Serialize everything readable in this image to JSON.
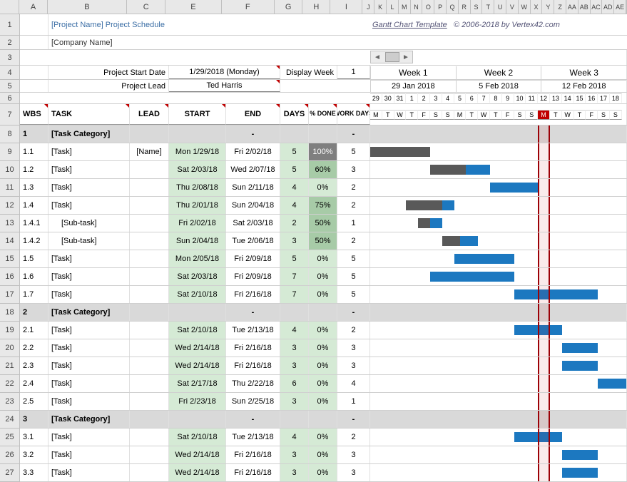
{
  "cols": [
    "A",
    "B",
    "C",
    "E",
    "F",
    "G",
    "H",
    "I",
    "J",
    "K",
    "L",
    "M",
    "N",
    "O",
    "P",
    "Q",
    "R",
    "S",
    "T",
    "U",
    "V",
    "W",
    "X",
    "Y",
    "Z",
    "AA",
    "AB",
    "AC",
    "AD",
    "AE"
  ],
  "title": "[Project Name] Project Schedule",
  "subtitle": "[Company Name]",
  "credit": {
    "link": "Gantt Chart Template",
    "rest": "© 2006-2018 by Vertex42.com"
  },
  "form": {
    "start_label": "Project Start Date",
    "start_value": "1/29/2018 (Monday)",
    "lead_label": "Project Lead",
    "lead_value": "Ted Harris",
    "display_week_label": "Display Week",
    "display_week_value": "1"
  },
  "weeks": [
    {
      "name": "Week 1",
      "date": "29 Jan 2018",
      "nums": [
        "29",
        "30",
        "31",
        "1",
        "2",
        "3",
        "4"
      ],
      "letters": [
        "M",
        "T",
        "W",
        "T",
        "F",
        "S",
        "S"
      ]
    },
    {
      "name": "Week 2",
      "date": "5 Feb 2018",
      "nums": [
        "5",
        "6",
        "7",
        "8",
        "9",
        "10",
        "11"
      ],
      "letters": [
        "M",
        "T",
        "W",
        "T",
        "F",
        "S",
        "S"
      ]
    },
    {
      "name": "Week 3",
      "date": "12 Feb 2018",
      "nums": [
        "12",
        "13",
        "14",
        "15",
        "16",
        "17",
        "18"
      ],
      "letters": [
        "M",
        "T",
        "W",
        "T",
        "F",
        "S",
        "S"
      ]
    }
  ],
  "today_index": 14,
  "headers": {
    "wbs": "WBS",
    "task": "TASK",
    "lead": "LEAD",
    "start": "START",
    "end": "END",
    "days": "DAYS",
    "pct": "% DONE",
    "work": "WORK DAYS"
  },
  "base_date": "2018-01-29",
  "rows": [
    {
      "n": 8,
      "cat": true,
      "wbs": "1",
      "task": "[Task Category]",
      "end": "-",
      "work": "-"
    },
    {
      "n": 9,
      "wbs": "1.1",
      "task": "[Task]",
      "lead": "[Name]",
      "start": "Mon 1/29/18",
      "end": "Fri 2/02/18",
      "days": "5",
      "pct": "100%",
      "work": "5",
      "bar": {
        "offset": 0,
        "len": 5,
        "done": 100,
        "grey": true
      }
    },
    {
      "n": 10,
      "wbs": "1.2",
      "task": "[Task]",
      "start": "Sat 2/03/18",
      "end": "Wed 2/07/18",
      "days": "5",
      "pct": "60%",
      "work": "3",
      "bar": {
        "offset": 5,
        "len": 5,
        "done": 60
      }
    },
    {
      "n": 11,
      "wbs": "1.3",
      "task": "[Task]",
      "start": "Thu 2/08/18",
      "end": "Sun 2/11/18",
      "days": "4",
      "pct": "0%",
      "work": "2",
      "bar": {
        "offset": 10,
        "len": 4,
        "done": 0
      }
    },
    {
      "n": 12,
      "wbs": "1.4",
      "task": "[Task]",
      "start": "Thu 2/01/18",
      "end": "Sun 2/04/18",
      "days": "4",
      "pct": "75%",
      "work": "2",
      "bar": {
        "offset": 3,
        "len": 4,
        "done": 75
      }
    },
    {
      "n": 13,
      "wbs": "1.4.1",
      "task": "[Sub-task]",
      "indent": 1,
      "start": "Fri 2/02/18",
      "end": "Sat 2/03/18",
      "days": "2",
      "pct": "50%",
      "work": "1",
      "bar": {
        "offset": 4,
        "len": 2,
        "done": 50
      }
    },
    {
      "n": 14,
      "wbs": "1.4.2",
      "task": "[Sub-task]",
      "indent": 1,
      "start": "Sun 2/04/18",
      "end": "Tue 2/06/18",
      "days": "3",
      "pct": "50%",
      "work": "2",
      "bar": {
        "offset": 6,
        "len": 3,
        "done": 50
      }
    },
    {
      "n": 15,
      "wbs": "1.5",
      "task": "[Task]",
      "start": "Mon 2/05/18",
      "end": "Fri 2/09/18",
      "days": "5",
      "pct": "0%",
      "work": "5",
      "bar": {
        "offset": 7,
        "len": 5,
        "done": 0
      }
    },
    {
      "n": 16,
      "wbs": "1.6",
      "task": "[Task]",
      "start": "Sat 2/03/18",
      "end": "Fri 2/09/18",
      "days": "7",
      "pct": "0%",
      "work": "5",
      "bar": {
        "offset": 5,
        "len": 7,
        "done": 0
      }
    },
    {
      "n": 17,
      "wbs": "1.7",
      "task": "[Task]",
      "start": "Sat 2/10/18",
      "end": "Fri 2/16/18",
      "days": "7",
      "pct": "0%",
      "work": "5",
      "bar": {
        "offset": 12,
        "len": 7,
        "done": 0
      }
    },
    {
      "n": 18,
      "cat": true,
      "wbs": "2",
      "task": "[Task Category]",
      "end": "-",
      "work": "-"
    },
    {
      "n": 19,
      "wbs": "2.1",
      "task": "[Task]",
      "start": "Sat 2/10/18",
      "end": "Tue 2/13/18",
      "days": "4",
      "pct": "0%",
      "work": "2",
      "bar": {
        "offset": 12,
        "len": 4,
        "done": 0
      }
    },
    {
      "n": 20,
      "wbs": "2.2",
      "task": "[Task]",
      "start": "Wed 2/14/18",
      "end": "Fri 2/16/18",
      "days": "3",
      "pct": "0%",
      "work": "3",
      "bar": {
        "offset": 16,
        "len": 3,
        "done": 0
      }
    },
    {
      "n": 21,
      "wbs": "2.3",
      "task": "[Task]",
      "start": "Wed 2/14/18",
      "end": "Fri 2/16/18",
      "days": "3",
      "pct": "0%",
      "work": "3",
      "bar": {
        "offset": 16,
        "len": 3,
        "done": 0
      }
    },
    {
      "n": 22,
      "wbs": "2.4",
      "task": "[Task]",
      "start": "Sat 2/17/18",
      "end": "Thu 2/22/18",
      "days": "6",
      "pct": "0%",
      "work": "4",
      "bar": {
        "offset": 19,
        "len": 6,
        "done": 0
      }
    },
    {
      "n": 23,
      "wbs": "2.5",
      "task": "[Task]",
      "start": "Fri 2/23/18",
      "end": "Sun 2/25/18",
      "days": "3",
      "pct": "0%",
      "work": "1"
    },
    {
      "n": 24,
      "cat": true,
      "wbs": "3",
      "task": "[Task Category]",
      "end": "-",
      "work": "-"
    },
    {
      "n": 25,
      "wbs": "3.1",
      "task": "[Task]",
      "start": "Sat 2/10/18",
      "end": "Tue 2/13/18",
      "days": "4",
      "pct": "0%",
      "work": "2",
      "bar": {
        "offset": 12,
        "len": 4,
        "done": 0
      }
    },
    {
      "n": 26,
      "wbs": "3.2",
      "task": "[Task]",
      "start": "Wed 2/14/18",
      "end": "Fri 2/16/18",
      "days": "3",
      "pct": "0%",
      "work": "3",
      "bar": {
        "offset": 16,
        "len": 3,
        "done": 0
      }
    },
    {
      "n": 27,
      "wbs": "3.3",
      "task": "[Task]",
      "start": "Wed 2/14/18",
      "end": "Fri 2/16/18",
      "days": "3",
      "pct": "0%",
      "work": "3",
      "bar": {
        "offset": 16,
        "len": 3,
        "done": 0
      }
    }
  ]
}
